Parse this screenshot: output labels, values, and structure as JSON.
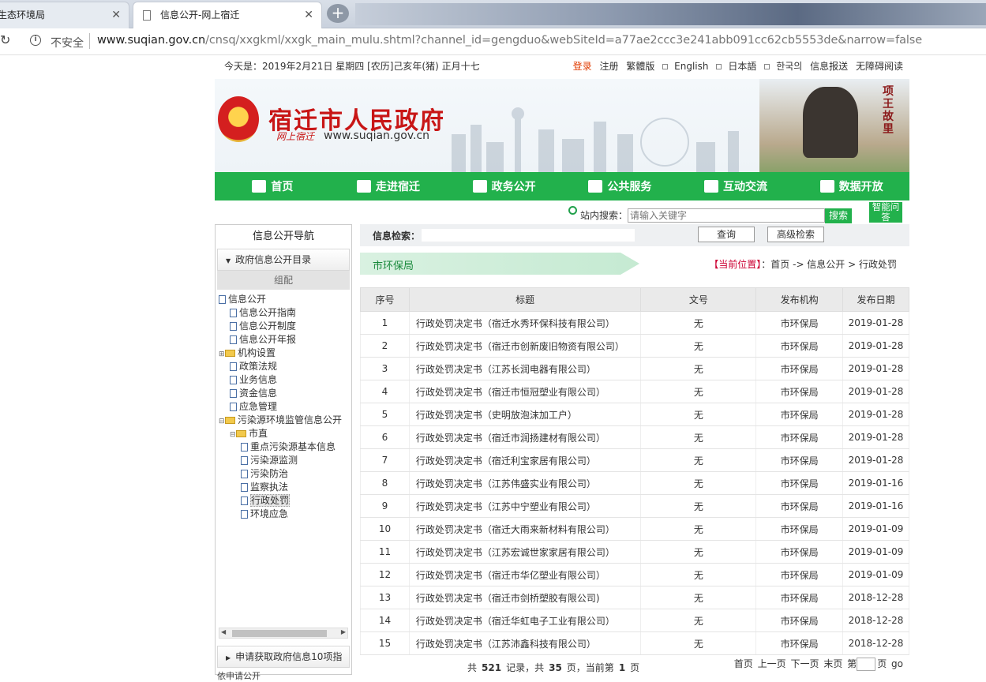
{
  "browser": {
    "tabs": [
      {
        "title": "生态环境局",
        "active": false
      },
      {
        "title": "信息公开-网上宿迁",
        "active": true
      }
    ],
    "new_tab": "+",
    "security": "不安全",
    "url_domain": "www.suqian.gov.cn",
    "url_path": "/cnsq/xxgkml/xxgk_main_mulu.shtml?channel_id=gengduo&webSiteId=a77ae2ccc3e241abb091cc62cb5553de&narrow=false"
  },
  "topbar": {
    "date": "今天是：2019年2月21日 星期四 [农历]己亥年(猪) 正月十七",
    "login": "登录",
    "register": "注册",
    "traditional": "繁體版",
    "english": "English",
    "japanese": "日本語",
    "korean": "한국의",
    "report": "信息报送",
    "accessibility": "无障碍阅读"
  },
  "banner": {
    "title": "宿迁市人民政府",
    "sub": "网上宿迁",
    "url": "www.suqian.gov.cn",
    "calligraphy": "项王故里"
  },
  "nav": [
    {
      "label": "首页",
      "icon": "home-icon"
    },
    {
      "label": "走进宿迁",
      "icon": "picture-icon"
    },
    {
      "label": "政务公开",
      "icon": "layers-icon"
    },
    {
      "label": "公共服务",
      "icon": "service-icon"
    },
    {
      "label": "互动交流",
      "icon": "chat-icon"
    },
    {
      "label": "数据开放",
      "icon": "data-icon"
    }
  ],
  "site_search": {
    "label": "站内搜索：",
    "placeholder": "请输入关键字",
    "button": "搜索",
    "smart": "智能问答"
  },
  "sidebar": {
    "title": "信息公开导航",
    "category": "政府信息公开目录",
    "group": "组配",
    "tree": [
      {
        "label": "信息公开",
        "level": 0,
        "type": "root"
      },
      {
        "label": "信息公开指南",
        "level": 1,
        "type": "doc"
      },
      {
        "label": "信息公开制度",
        "level": 1,
        "type": "doc"
      },
      {
        "label": "信息公开年报",
        "level": 1,
        "type": "doc"
      },
      {
        "label": "机构设置",
        "level": 0,
        "type": "folder-closed"
      },
      {
        "label": "政策法规",
        "level": 1,
        "type": "doc"
      },
      {
        "label": "业务信息",
        "level": 1,
        "type": "doc"
      },
      {
        "label": "资金信息",
        "level": 1,
        "type": "doc"
      },
      {
        "label": "应急管理",
        "level": 1,
        "type": "doc"
      },
      {
        "label": "污染源环境监管信息公开",
        "level": 0,
        "type": "folder-open"
      },
      {
        "label": "市直",
        "level": 1,
        "type": "folder-open"
      },
      {
        "label": "重点污染源基本信息",
        "level": 2,
        "type": "doc"
      },
      {
        "label": "污染源监测",
        "level": 2,
        "type": "doc"
      },
      {
        "label": "污染防治",
        "level": 2,
        "type": "doc"
      },
      {
        "label": "监察执法",
        "level": 2,
        "type": "doc"
      },
      {
        "label": "行政处罚",
        "level": 2,
        "type": "doc",
        "selected": true
      },
      {
        "label": "环境应急",
        "level": 2,
        "type": "doc"
      }
    ],
    "category2": "申请获取政府信息10项指",
    "more": "依申请公开"
  },
  "info_search": {
    "label": "信息检索：",
    "query_button": "查询",
    "advanced_button": "高级检索"
  },
  "section": {
    "name": "市环保局",
    "crumb_here": "【当前位置】",
    "crumb_path": "：首页 -> 信息公开 > 行政处罚"
  },
  "table": {
    "headers": [
      "序号",
      "标题",
      "文号",
      "发布机构",
      "发布日期"
    ],
    "rows": [
      {
        "no": "1",
        "title": "行政处罚决定书（宿迁水秀环保科技有限公司）",
        "doc": "无",
        "org": "市环保局",
        "date": "2019-01-28"
      },
      {
        "no": "2",
        "title": "行政处罚决定书（宿迁市创新废旧物资有限公司）",
        "doc": "无",
        "org": "市环保局",
        "date": "2019-01-28"
      },
      {
        "no": "3",
        "title": "行政处罚决定书（江苏长润电器有限公司）",
        "doc": "无",
        "org": "市环保局",
        "date": "2019-01-28"
      },
      {
        "no": "4",
        "title": "行政处罚决定书（宿迁市恒冠塑业有限公司）",
        "doc": "无",
        "org": "市环保局",
        "date": "2019-01-28"
      },
      {
        "no": "5",
        "title": "行政处罚决定书（史明放泡沫加工户）",
        "doc": "无",
        "org": "市环保局",
        "date": "2019-01-28"
      },
      {
        "no": "6",
        "title": "行政处罚决定书（宿迁市润扬建材有限公司）",
        "doc": "无",
        "org": "市环保局",
        "date": "2019-01-28"
      },
      {
        "no": "7",
        "title": "行政处罚决定书（宿迁利宝家居有限公司）",
        "doc": "无",
        "org": "市环保局",
        "date": "2019-01-28"
      },
      {
        "no": "8",
        "title": "行政处罚决定书（江苏伟盛实业有限公司）",
        "doc": "无",
        "org": "市环保局",
        "date": "2019-01-16"
      },
      {
        "no": "9",
        "title": "行政处罚决定书（江苏中宁塑业有限公司）",
        "doc": "无",
        "org": "市环保局",
        "date": "2019-01-16"
      },
      {
        "no": "10",
        "title": "行政处罚决定书（宿迁大雨来新材料有限公司）",
        "doc": "无",
        "org": "市环保局",
        "date": "2019-01-09"
      },
      {
        "no": "11",
        "title": "行政处罚决定书（江苏宏诚世家家居有限公司）",
        "doc": "无",
        "org": "市环保局",
        "date": "2019-01-09"
      },
      {
        "no": "12",
        "title": "行政处罚决定书（宿迁市华亿塑业有限公司）",
        "doc": "无",
        "org": "市环保局",
        "date": "2019-01-09"
      },
      {
        "no": "13",
        "title": "行政处罚决定书（宿迁市剑桥塑胶有限公司)",
        "doc": "无",
        "org": "市环保局",
        "date": "2018-12-28"
      },
      {
        "no": "14",
        "title": "行政处罚决定书（宿迁华虹电子工业有限公司）",
        "doc": "无",
        "org": "市环保局",
        "date": "2018-12-28"
      },
      {
        "no": "15",
        "title": "行政处罚决定书（江苏沛鑫科技有限公司）",
        "doc": "无",
        "org": "市环保局",
        "date": "2018-12-28"
      }
    ]
  },
  "pager": {
    "total_prefix": "共",
    "total": "521",
    "records_mid": "记录，共",
    "pages": "35",
    "pages_mid": "页，当前第",
    "current": "1",
    "pages_suffix": "页",
    "first": "首页",
    "prev": "上一页",
    "next": "下一页",
    "last": "末页",
    "goto_prefix": "第",
    "goto_suffix": "页",
    "go": "go"
  },
  "colors": {
    "nav_green": "#22b14c",
    "brand_red": "#c81616",
    "login_orange": "#e03b00"
  }
}
